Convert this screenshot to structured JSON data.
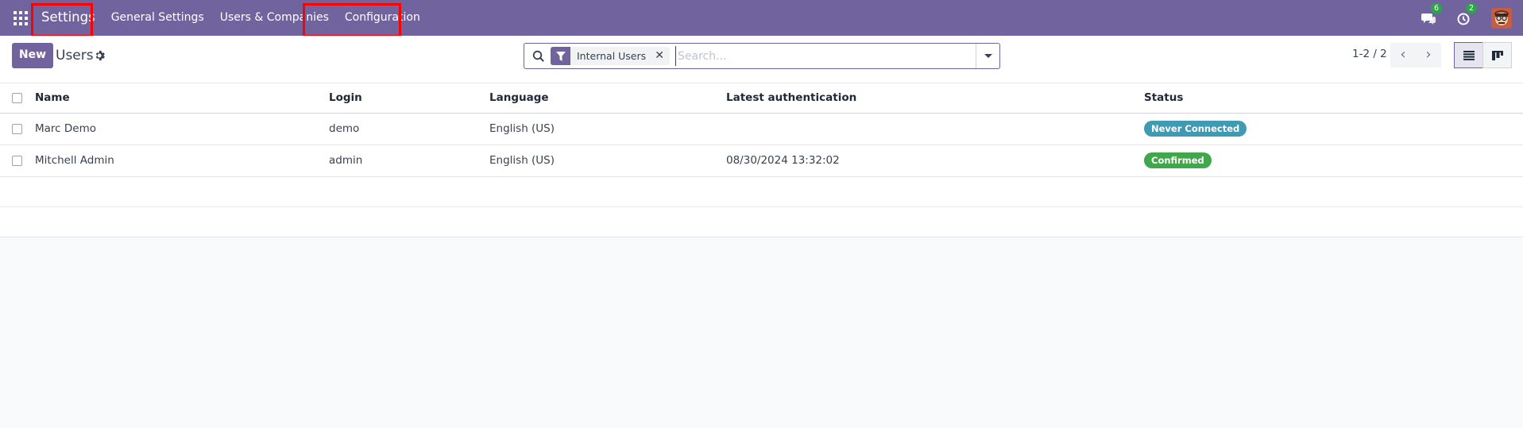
{
  "navbar": {
    "app_name": "Settings",
    "menu": [
      "General Settings",
      "Users & Companies",
      "Configuration"
    ],
    "messages_count": "6",
    "activities_count": "2"
  },
  "control": {
    "new_label": "New",
    "title": "Users",
    "search": {
      "facet_label": "Internal Users",
      "placeholder": "Search..."
    },
    "pager": "1-2 / 2"
  },
  "table": {
    "columns": [
      "Name",
      "Login",
      "Language",
      "Latest authentication",
      "Status"
    ],
    "rows": [
      {
        "name": "Marc Demo",
        "login": "demo",
        "language": "English (US)",
        "latest_auth": "",
        "status": "Never Connected",
        "status_color": "#3f9ab3"
      },
      {
        "name": "Mitchell Admin",
        "login": "admin",
        "language": "English (US)",
        "latest_auth": "08/30/2024 13:32:02",
        "status": "Confirmed",
        "status_color": "#40a74a"
      }
    ]
  },
  "colors": {
    "brand": "#71639e",
    "highlight": "#ff0000"
  }
}
